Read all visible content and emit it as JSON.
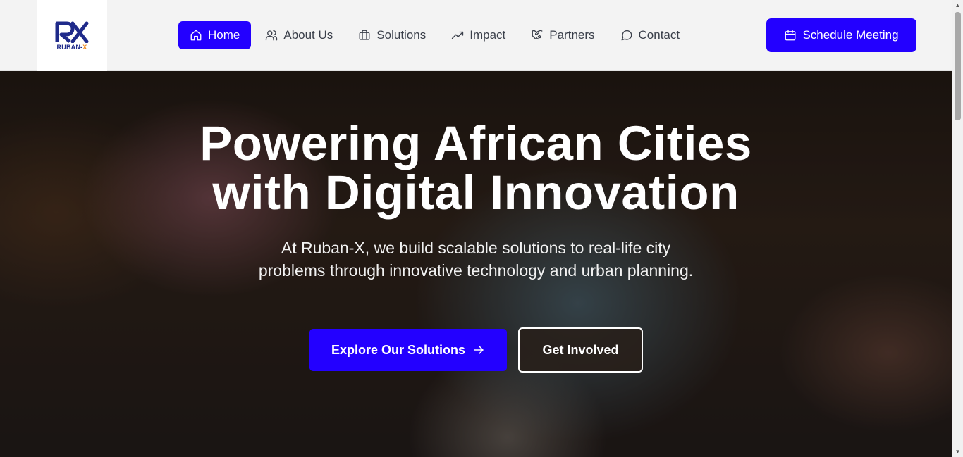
{
  "brand": {
    "logo_text_main": "RUBAN-",
    "logo_text_accent": "X",
    "colors": {
      "primary": "#2300ff",
      "logo_navy": "#1f2a8a",
      "logo_orange": "#f08a1d"
    }
  },
  "nav": {
    "items": [
      {
        "label": "Home",
        "icon": "home-icon",
        "active": true
      },
      {
        "label": "About Us",
        "icon": "users-icon",
        "active": false
      },
      {
        "label": "Solutions",
        "icon": "briefcase-icon",
        "active": false
      },
      {
        "label": "Impact",
        "icon": "trending-up-icon",
        "active": false
      },
      {
        "label": "Partners",
        "icon": "handshake-icon",
        "active": false
      },
      {
        "label": "Contact",
        "icon": "message-circle-icon",
        "active": false
      }
    ],
    "cta": {
      "label": "Schedule Meeting",
      "icon": "calendar-icon"
    }
  },
  "hero": {
    "title_line1": "Powering African Cities",
    "title_line2": "with Digital Innovation",
    "subtitle": "At Ruban-X, we build scalable solutions to real-life city problems through innovative technology and urban planning.",
    "primary_button": {
      "label": "Explore Our Solutions",
      "icon": "arrow-right-icon"
    },
    "secondary_button": {
      "label": "Get Involved"
    }
  }
}
